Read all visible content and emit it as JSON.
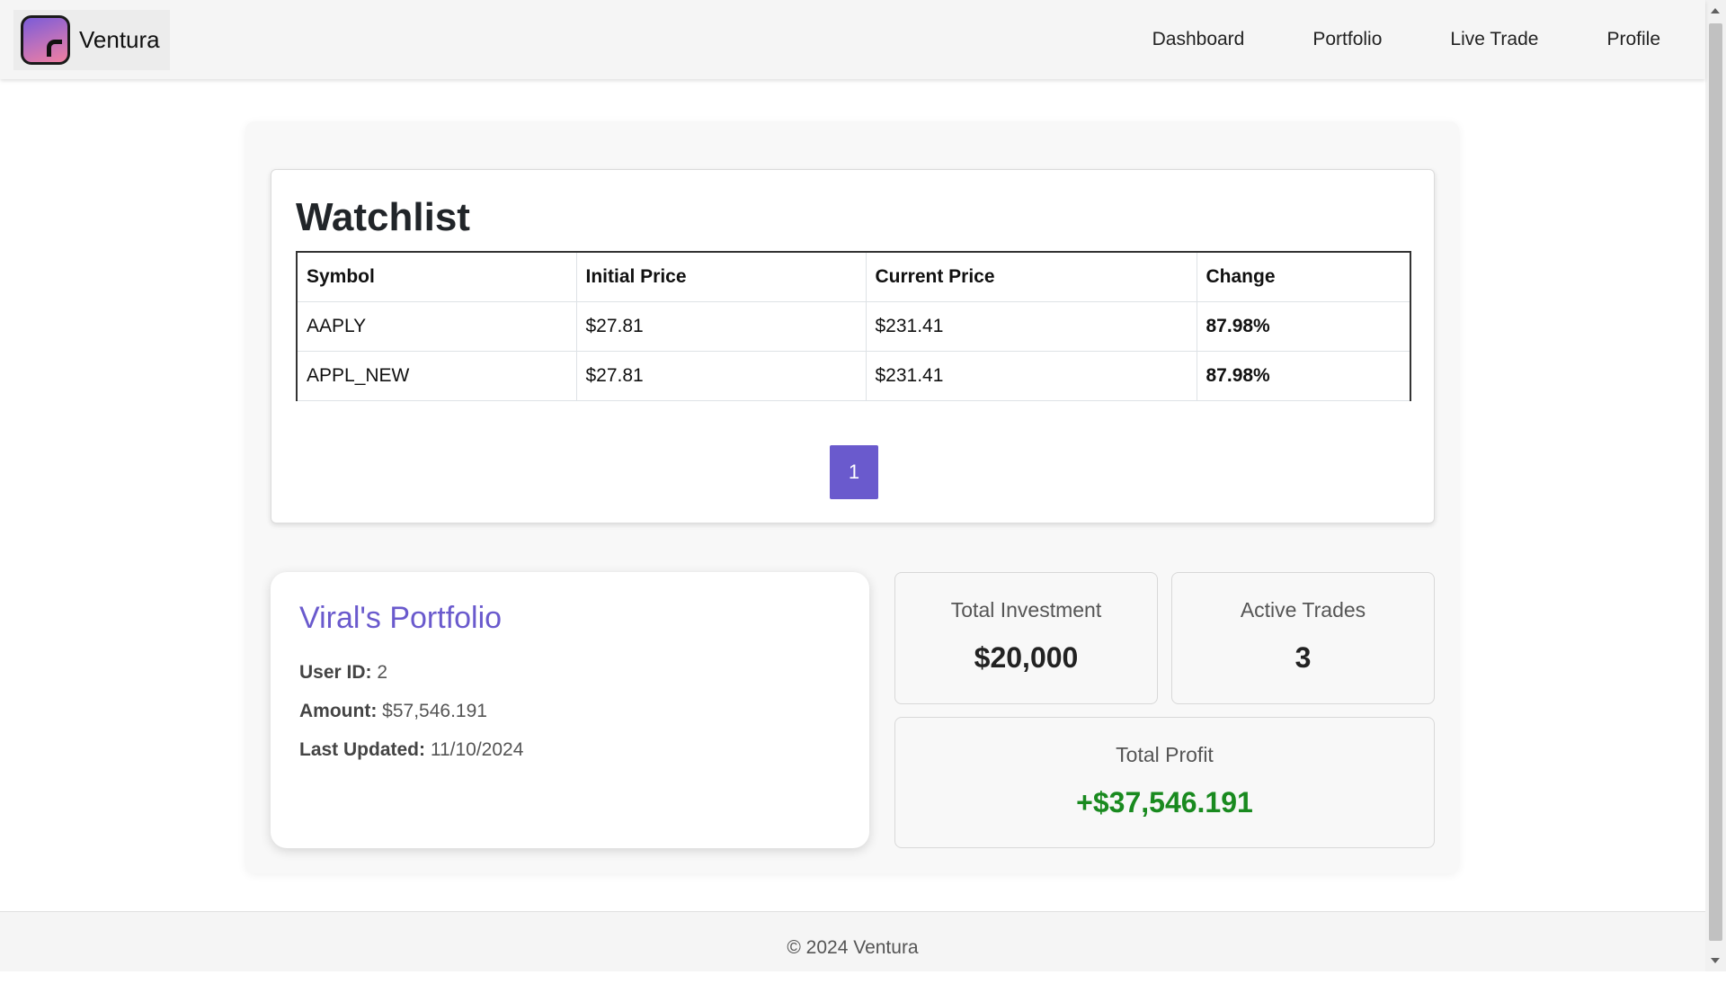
{
  "brand": {
    "name": "Ventura",
    "logo_icon": "ventura-logo-icon"
  },
  "nav": {
    "items": [
      {
        "label": "Dashboard"
      },
      {
        "label": "Portfolio"
      },
      {
        "label": "Live Trade"
      },
      {
        "label": "Profile"
      }
    ]
  },
  "watchlist": {
    "title": "Watchlist",
    "columns": [
      "Symbol",
      "Initial Price",
      "Current Price",
      "Change"
    ],
    "rows": [
      {
        "symbol": "AAPLY",
        "initial_price": "$27.81",
        "current_price": "$231.41",
        "change": "87.98%"
      },
      {
        "symbol": "APPL_NEW",
        "initial_price": "$27.81",
        "current_price": "$231.41",
        "change": "87.98%"
      }
    ],
    "pagination": {
      "current_page": "1"
    }
  },
  "portfolio": {
    "title": "Viral's Portfolio",
    "user_id_label": "User ID:",
    "user_id": "2",
    "amount_label": "Amount:",
    "amount": "$57,546.191",
    "last_updated_label": "Last Updated:",
    "last_updated": "11/10/2024"
  },
  "stats": {
    "total_investment_label": "Total Investment",
    "total_investment": "$20,000",
    "active_trades_label": "Active Trades",
    "active_trades": "3",
    "total_profit_label": "Total Profit",
    "total_profit": "+$37,546.191"
  },
  "footer": {
    "text": "© 2024 Ventura"
  },
  "colors": {
    "accent": "#6a5acd",
    "positive": "#198a1f",
    "navbar_bg": "#f5f5f5"
  }
}
